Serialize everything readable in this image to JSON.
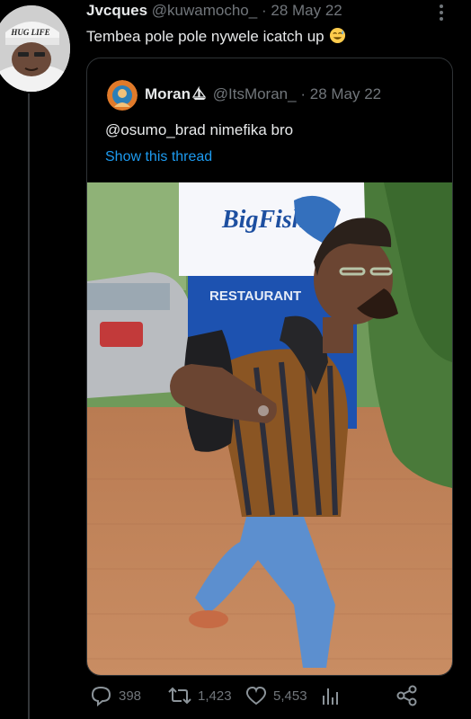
{
  "tweet": {
    "display_name": "Jvcques",
    "handle": "@kuwamocho_",
    "separator": "·",
    "date": "28 May 22",
    "text": "Tembea pole pole nywele icatch up",
    "avatar_cap_text": "HUG LIFE",
    "emoji": "sweat-smile-icon"
  },
  "quoted": {
    "display_name": "Moran",
    "handle": "@ItsMoran_",
    "separator": "·",
    "date": "28 May 22",
    "text": "@osumo_brad nimefika bro",
    "show_thread": "Show this thread",
    "photo": {
      "sign_brand": "BigFish",
      "sign_banner": "RESTAURANT"
    }
  },
  "actions": {
    "replies": "398",
    "retweets": "1,423",
    "likes": "5,453"
  },
  "colors": {
    "background": "#000000",
    "accent": "#1d9bf0",
    "muted": "#71767b",
    "border": "#2f3336"
  }
}
